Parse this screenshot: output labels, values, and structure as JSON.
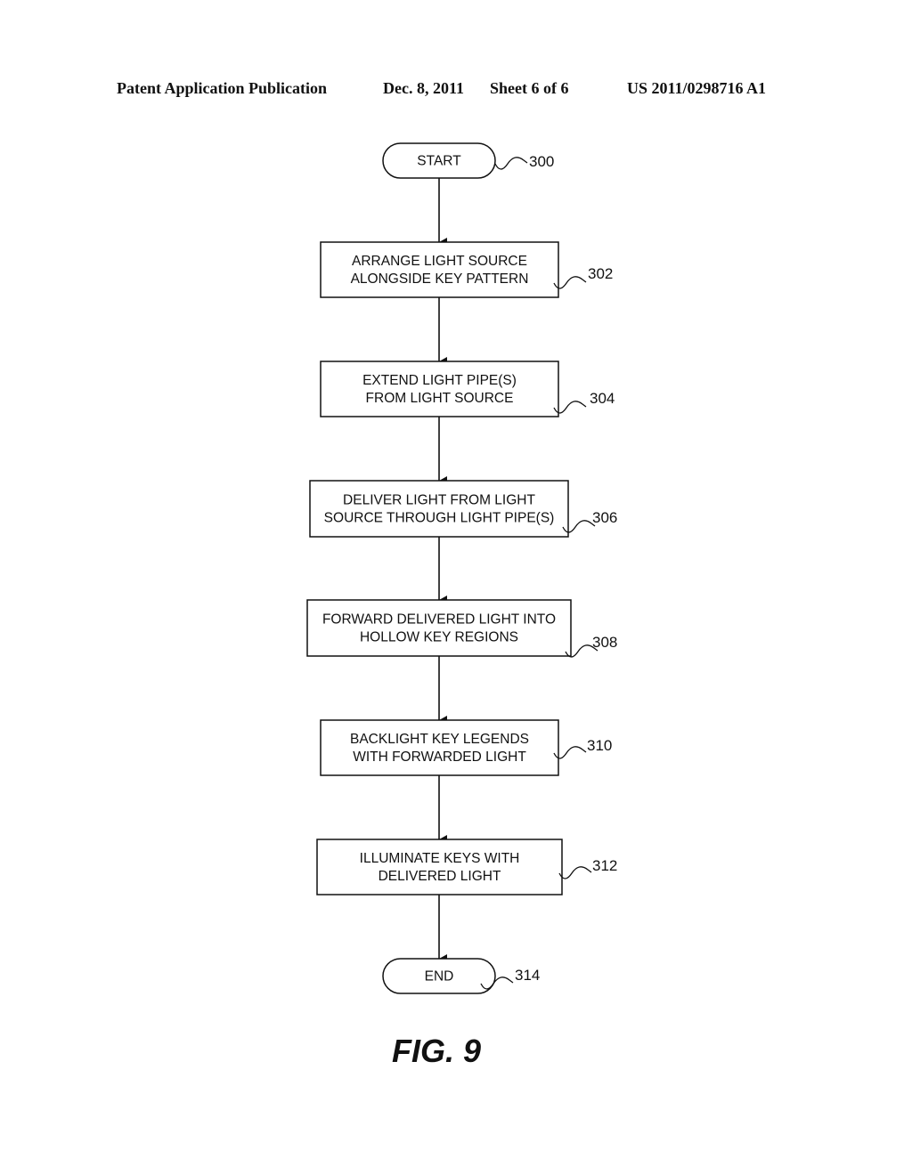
{
  "header": {
    "publication": "Patent Application Publication",
    "date": "Dec. 8, 2011",
    "sheet": "Sheet 6 of 6",
    "number": "US 2011/0298716 A1"
  },
  "flowchart": {
    "nodes": [
      {
        "id": "start",
        "shape": "terminal",
        "lines": [
          "START"
        ],
        "ref": "300"
      },
      {
        "id": "arrange",
        "shape": "process",
        "lines": [
          "ARRANGE LIGHT SOURCE",
          "ALONGSIDE KEY PATTERN"
        ],
        "ref": "302"
      },
      {
        "id": "extend",
        "shape": "process",
        "lines": [
          "EXTEND LIGHT PIPE(S)",
          "FROM LIGHT SOURCE"
        ],
        "ref": "304"
      },
      {
        "id": "deliver",
        "shape": "process",
        "lines": [
          "DELIVER LIGHT FROM LIGHT",
          "SOURCE THROUGH LIGHT PIPE(S)"
        ],
        "ref": "306"
      },
      {
        "id": "forward",
        "shape": "process",
        "lines": [
          "FORWARD DELIVERED LIGHT INTO",
          "HOLLOW KEY REGIONS"
        ],
        "ref": "308"
      },
      {
        "id": "backlight",
        "shape": "process",
        "lines": [
          "BACKLIGHT KEY LEGENDS",
          "WITH FORWARDED LIGHT"
        ],
        "ref": "310"
      },
      {
        "id": "illuminate",
        "shape": "process",
        "lines": [
          "ILLUMINATE KEYS WITH",
          "DELIVERED LIGHT"
        ],
        "ref": "312"
      },
      {
        "id": "end",
        "shape": "terminal",
        "lines": [
          "END"
        ],
        "ref": "314"
      }
    ],
    "edges": [
      [
        "start",
        "arrange"
      ],
      [
        "arrange",
        "extend"
      ],
      [
        "extend",
        "deliver"
      ],
      [
        "deliver",
        "forward"
      ],
      [
        "forward",
        "backlight"
      ],
      [
        "backlight",
        "illuminate"
      ],
      [
        "illuminate",
        "end"
      ]
    ]
  },
  "figure_label": "FIG. 9"
}
